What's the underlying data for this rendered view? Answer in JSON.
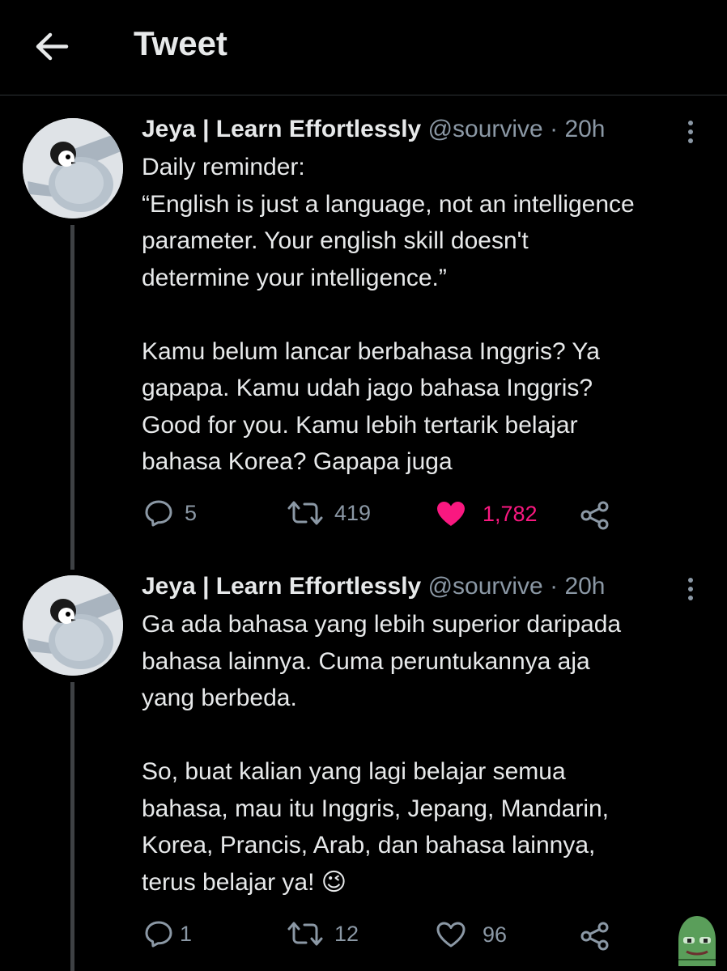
{
  "header": {
    "title": "Tweet"
  },
  "tweets": [
    {
      "author_name": "Jeya | Learn Effortlessly",
      "handle": "@sourvive",
      "separator": "·",
      "time": "20h",
      "lines": [
        "Daily reminder:",
        "“English is just a language, not an intelligence",
        "parameter. Your english skill doesn't",
        "determine your intelligence.”",
        "",
        "Kamu belum lancar berbahasa Inggris? Ya",
        "gapapa. Kamu udah jago bahasa Inggris?",
        "Good for you. Kamu lebih tertarik belajar",
        "bahasa Korea? Gapapa juga"
      ],
      "replies": "5",
      "retweets": "419",
      "likes": "1,782",
      "liked": true
    },
    {
      "author_name": "Jeya | Learn Effortlessly",
      "handle": "@sourvive",
      "separator": "·",
      "time": "20h",
      "lines": [
        "Ga ada bahasa yang lebih superior daripada",
        "bahasa lainnya. Cuma peruntukannya aja",
        "yang berbeda.",
        "",
        "So, buat kalian yang lagi belajar semua",
        "bahasa, mau itu Inggris, Jepang, Mandarin,",
        "Korea, Prancis, Arab, dan bahasa lainnya,",
        "terus belajar ya! 😉"
      ],
      "replies": "1",
      "retweets": "12",
      "likes": "96",
      "liked": false
    }
  ],
  "colors": {
    "background": "#000000",
    "text": "#e7e9ea",
    "muted": "#8b98a5",
    "like_active": "#f91880",
    "divider": "#2f3336"
  },
  "icons": [
    "back-arrow-icon",
    "more-icon",
    "reply-icon",
    "retweet-icon",
    "heart-icon",
    "share-icon",
    "wink-emoji-icon",
    "penguin-avatar",
    "pepe-sticker"
  ]
}
